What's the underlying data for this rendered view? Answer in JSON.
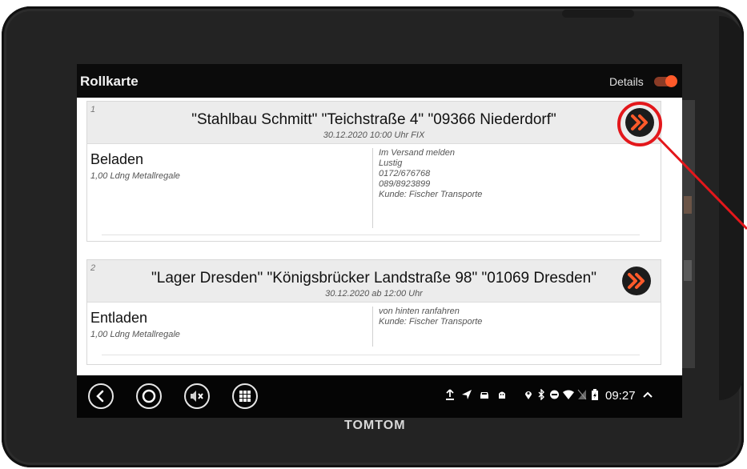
{
  "app": {
    "title": "Rollkarte",
    "details_label": "Details",
    "details_toggle_on": true,
    "accent_color": "#ff5a2a"
  },
  "stops": [
    {
      "number": "1",
      "address": "\"Stahlbau Schmitt\" \"Teichstraße 4\" \"09366 Niederdorf\"",
      "time": "30.12.2020 10:00 Uhr FIX",
      "action": "Beladen",
      "cargo": "1,00 Ldng Metallregale",
      "notes": [
        "Im Versand melden",
        "Lustig",
        "0172/676768",
        "089/8923899",
        "Kunde: Fischer Transporte"
      ],
      "go_icon": "double-chevron-right-icon"
    },
    {
      "number": "2",
      "address": "\"Lager Dresden\" \"Königsbrücker Landstraße 98\" \"01069 Dresden\"",
      "time": "30.12.2020 ab 12:00 Uhr",
      "action": "Entladen",
      "cargo": "1,00 Ldng Metallregale",
      "notes": [
        "von hinten ranfahren",
        "Kunde: Fischer Transporte"
      ],
      "go_icon": "double-chevron-right-icon"
    }
  ],
  "navbar": {
    "buttons": [
      "back-icon",
      "home-icon",
      "mute-icon",
      "apps-grid-icon"
    ],
    "status_icons": [
      "upload-icon",
      "navigation-arrow-icon",
      "car-icon",
      "android-icon",
      "location-pin-icon",
      "bluetooth-icon",
      "do-not-disturb-icon",
      "wifi-icon",
      "no-sim-icon",
      "battery-icon"
    ],
    "clock": "09:27",
    "expand_icon": "chevron-up-icon"
  },
  "device": {
    "brand": "TOMTOM"
  },
  "annotation": {
    "highlight_color": "#e3171b"
  }
}
